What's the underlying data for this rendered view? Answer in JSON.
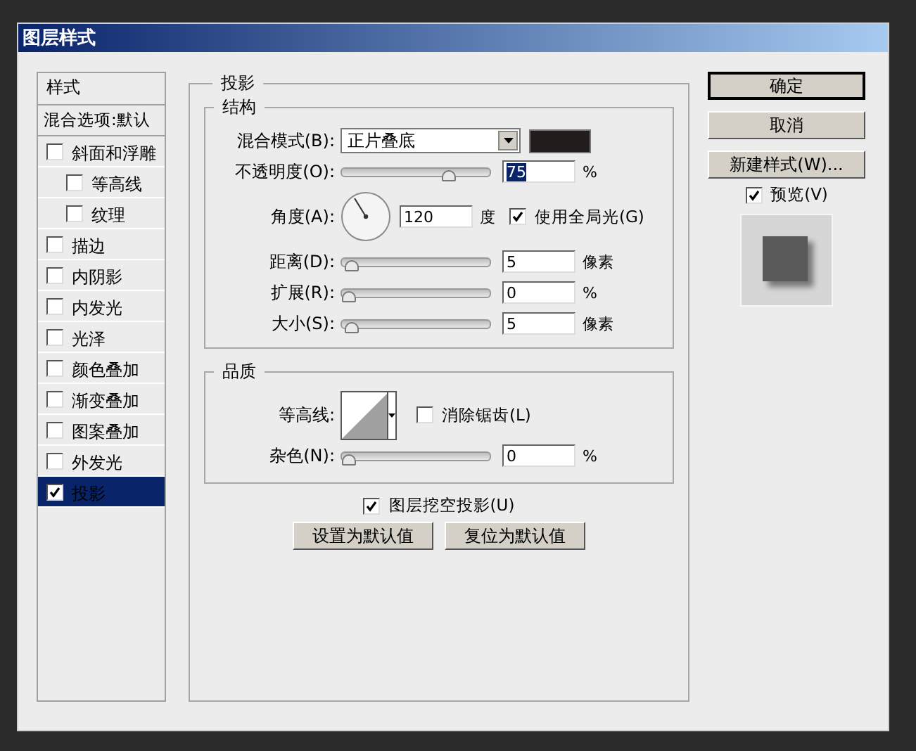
{
  "window": {
    "title": "图层样式"
  },
  "sidebar": {
    "header": "样式",
    "blend_options": "混合选项:默认",
    "items": [
      {
        "label": "斜面和浮雕",
        "checked": false,
        "selected": false,
        "children": [
          {
            "label": "等高线",
            "checked": false,
            "selected": false
          },
          {
            "label": "纹理",
            "checked": false,
            "selected": false
          }
        ]
      },
      {
        "label": "描边",
        "checked": false,
        "selected": false
      },
      {
        "label": "内阴影",
        "checked": false,
        "selected": false
      },
      {
        "label": "内发光",
        "checked": false,
        "selected": false
      },
      {
        "label": "光泽",
        "checked": false,
        "selected": false
      },
      {
        "label": "颜色叠加",
        "checked": false,
        "selected": false
      },
      {
        "label": "渐变叠加",
        "checked": false,
        "selected": false
      },
      {
        "label": "图案叠加",
        "checked": false,
        "selected": false
      },
      {
        "label": "外发光",
        "checked": false,
        "selected": false
      },
      {
        "label": "投影",
        "checked": true,
        "selected": true
      }
    ]
  },
  "drop_shadow": {
    "title": "投影",
    "structure": {
      "title": "结构",
      "blend_mode": {
        "label": "混合模式(B):",
        "value": "正片叠底",
        "color": "#231c1c"
      },
      "opacity": {
        "label": "不透明度(O):",
        "level": 0.75,
        "value": "75",
        "unit": "%"
      },
      "angle": {
        "label": "角度(A):",
        "value": "120",
        "unit": "度",
        "global_light": {
          "label": "使用全局光(G)",
          "checked": true
        }
      },
      "sliders": [
        {
          "label": "距离(D):",
          "level": 0.02,
          "value": "5",
          "unit": "像素"
        },
        {
          "label": "扩展(R):",
          "level": 0,
          "value": "0",
          "unit": "%"
        },
        {
          "label": "大小(S):",
          "level": 0.02,
          "value": "5",
          "unit": "像素"
        }
      ]
    },
    "quality": {
      "title": "品质",
      "contour": {
        "label": "等高线:"
      },
      "anti_alias": {
        "label": "消除锯齿(L)",
        "checked": false
      },
      "noise": {
        "label": "杂色(N):",
        "level": 0,
        "value": "0",
        "unit": "%"
      }
    },
    "knockout": {
      "label": "图层挖空投影(U)",
      "checked": true
    },
    "buttons": [
      "设置为默认值",
      "复位为默认值"
    ]
  },
  "actions": [
    {
      "label": "确定",
      "default": true
    },
    {
      "label": "取消",
      "default": false
    },
    {
      "label": "新建样式(W)...",
      "default": false
    }
  ],
  "preview": {
    "label": "预览(V)",
    "checked": true
  }
}
